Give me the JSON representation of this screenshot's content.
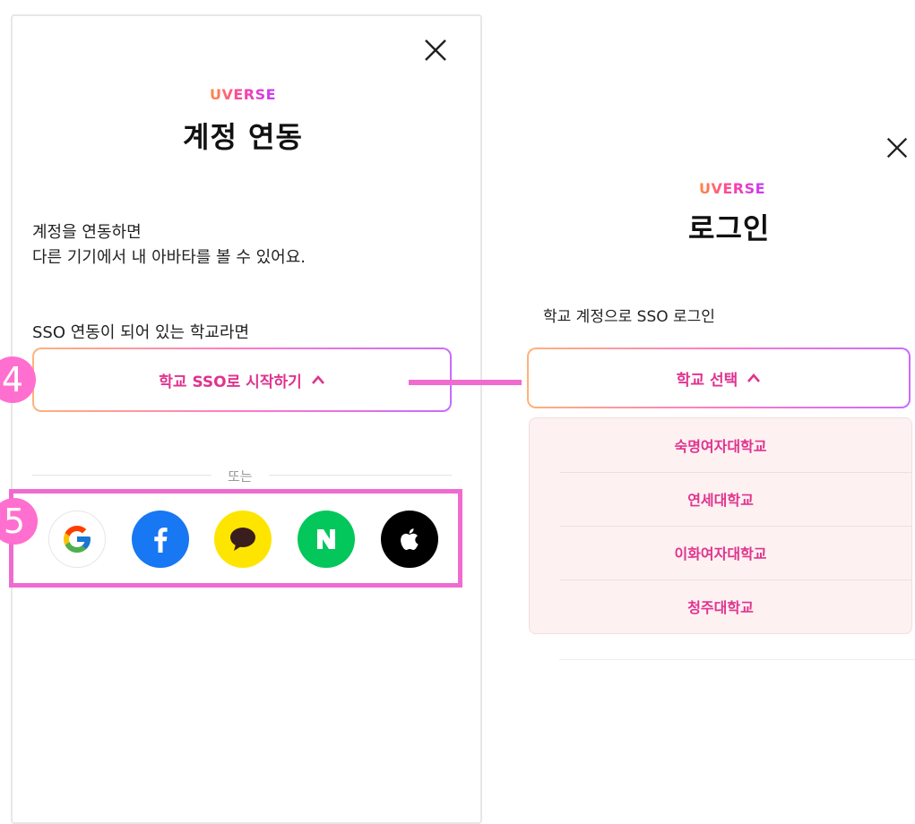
{
  "left_panel": {
    "brand": "UVERSE",
    "title": "계정 연동",
    "description_line1": "계정을 연동하면",
    "description_line2": "다른 기기에서 내 아바타를 볼 수 있어요.",
    "sso_hint": "SSO 연동이 되어 있는 학교라면",
    "sso_button_label": "학교 SSO로 시작하기",
    "divider_text": "또는",
    "step_sso": "4",
    "step_social": "5",
    "social_logins": [
      {
        "name": "google",
        "icon": "google-icon",
        "color": "#ffffff"
      },
      {
        "name": "facebook",
        "icon": "facebook-icon",
        "color": "#1877f2"
      },
      {
        "name": "kakao",
        "icon": "kakao-icon",
        "color": "#fee500"
      },
      {
        "name": "naver",
        "icon": "naver-icon",
        "color": "#03c75a"
      },
      {
        "name": "apple",
        "icon": "apple-icon",
        "color": "#000000"
      }
    ]
  },
  "right_panel": {
    "brand": "UVERSE",
    "title": "로그인",
    "school_login_label": "학교 계정으로 SSO 로그인",
    "school_select_label": "학교 선택",
    "schools": [
      "숙명여자대학교",
      "연세대학교",
      "이화여자대학교",
      "청주대학교"
    ]
  },
  "colors": {
    "accent_pink": "#e0338f",
    "badge_pink": "#ff6fcf",
    "highlight_border": "#f06bd0",
    "list_background": "#fdf1f1"
  }
}
